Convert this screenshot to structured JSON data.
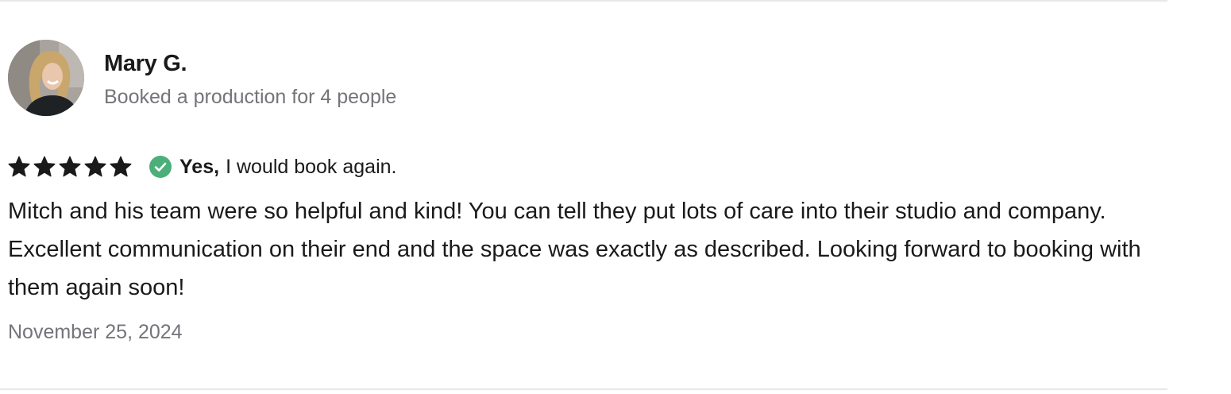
{
  "review": {
    "reviewer": {
      "name": "Mary G.",
      "avatar_icon": "reviewer-photo",
      "booking_info": "Booked a production for 4 people"
    },
    "rating": {
      "stars": 5,
      "max_stars": 5,
      "star_icon": "star-icon",
      "star_color": "#1a1a1a"
    },
    "rebook": {
      "icon": "check-circle-icon",
      "icon_color": "#4caf7a",
      "yes_label": "Yes,",
      "text": "I would book again."
    },
    "body": "Mitch and his team were so helpful and kind! You can tell they put lots of care into their studio and company. Excellent communication on their end and the space was exactly as described. Looking forward to booking with them again soon!",
    "date": "November 25, 2024"
  }
}
